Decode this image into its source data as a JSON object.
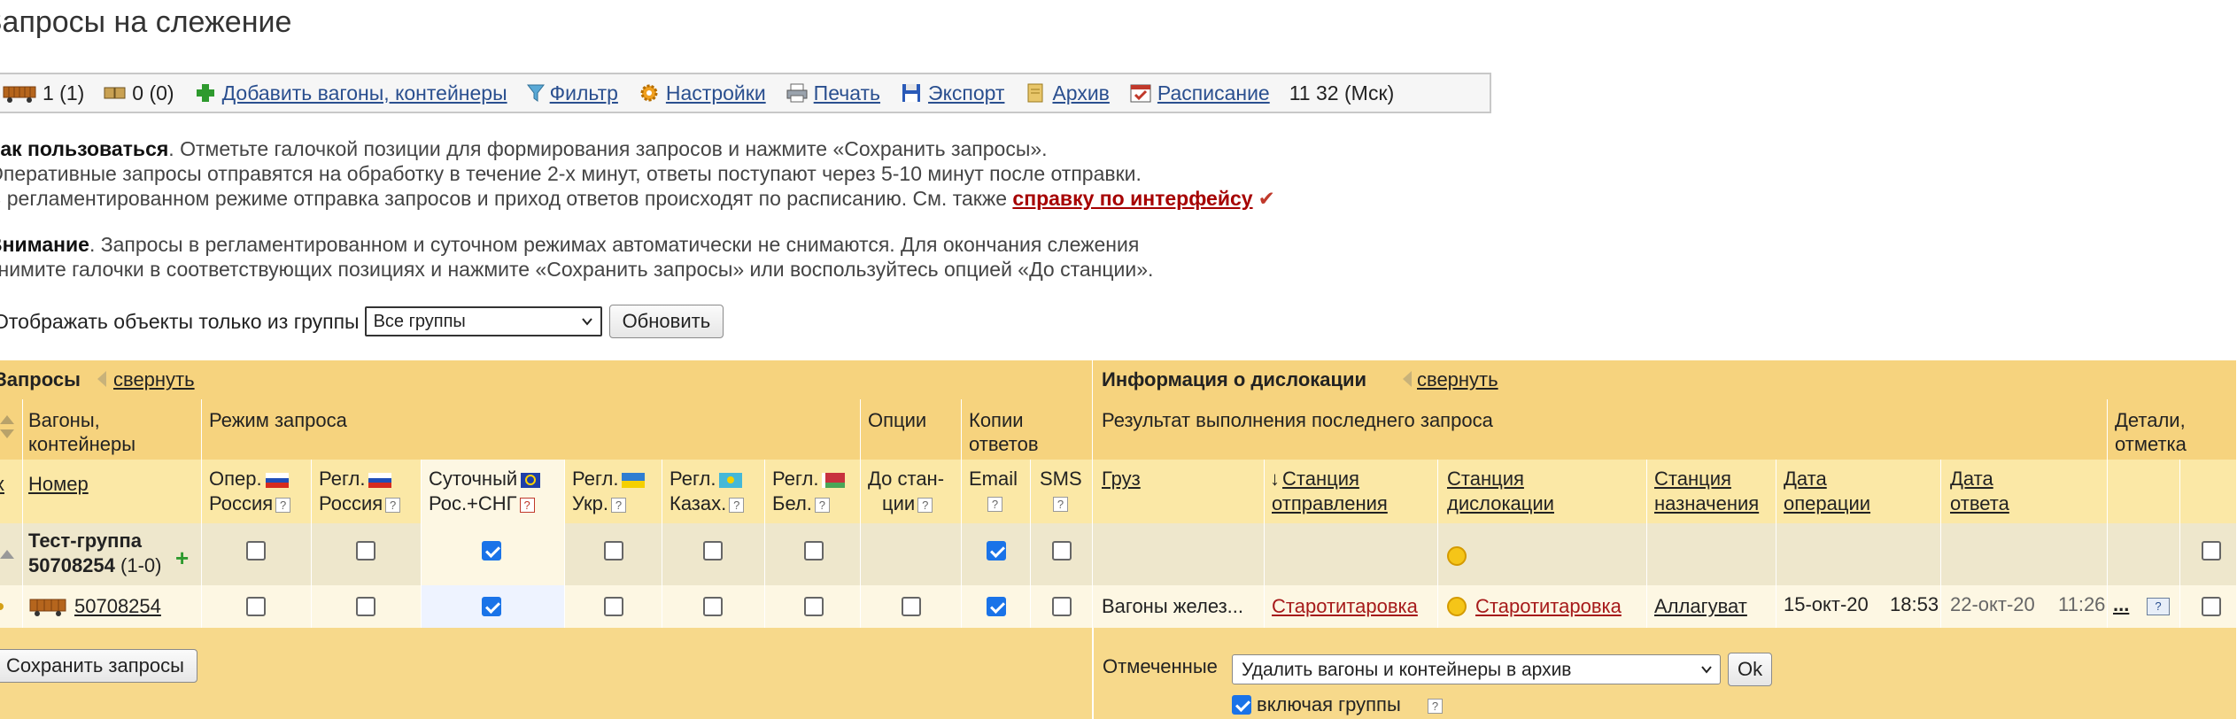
{
  "page": {
    "title": "Запросы на слежение"
  },
  "toolbar": {
    "wagons_count": "1 (1)",
    "containers_count": "0 (0)",
    "add": "Добавить вагоны, контейнеры",
    "filter": "Фильтр",
    "settings": "Настройки",
    "print": "Печать",
    "export": "Экспорт",
    "archive": "Архив",
    "schedule": "Расписание",
    "time": "11 32 (Мск)"
  },
  "help": {
    "how_bold": "Как пользоваться",
    "how_text": ". Отметьте галочкой позиции для формирования запросов и нажмите «Сохранить запросы».",
    "line2": "Оперативные запросы отправятся на обработку в течение 2-х минут, ответы поступают через 5-10 минут после отправки.",
    "line3": "В регламентированном режиме отправка запросов и приход ответов происходят по расписанию. См. также ",
    "link": "справку по интерфейсу",
    "attention_bold": "Внимание",
    "attention_text": ". Запросы в регламентированном и суточном режимах автоматически не снимаются. Для окончания слежения",
    "attention_line2": "снимите галочки в соответствующих позициях и нажмите «Сохранить запросы» или воспользуйтесь опцией «До станции»."
  },
  "filter": {
    "label": "Отображать объекты только из группы",
    "selected": "Все группы",
    "refresh": "Обновить"
  },
  "table": {
    "requests_title": "Запросы",
    "collapse": "свернуть",
    "dislocation_title": "Информация о дислокации",
    "col_wagons": "Вагоны, контейнеры",
    "col_mode": "Режим запроса",
    "col_options": "Опции",
    "col_copies": "Копии ответов",
    "col_result": "Результат выполнения последнего запроса",
    "col_details": "Детали, отметка",
    "col_number": "Номер",
    "modes": [
      {
        "line1": "Опер.",
        "line2": "Россия"
      },
      {
        "line1": "Регл.",
        "line2": "Россия"
      },
      {
        "line1": "Суточный",
        "line2": "Рос.+СНГ"
      },
      {
        "line1": "Регл.",
        "line2": "Укр."
      },
      {
        "line1": "Регл.",
        "line2": "Казах."
      },
      {
        "line1": "Регл.",
        "line2": "Бел."
      }
    ],
    "to_station": {
      "line1": "До стан-",
      "line2": "ции"
    },
    "email": "Email",
    "sms": "SMS",
    "result_cols": {
      "cargo": "Груз",
      "dep_station_1": "Станция",
      "dep_station_2": "отправления",
      "disl_station_1": "Станция",
      "disl_station_2": "дислокации",
      "dest_station_1": "Станция",
      "dest_station_2": "назначения",
      "op_date_1": "Дата",
      "op_date_2": "операции",
      "ans_date_1": "Дата",
      "ans_date_2": "ответа"
    },
    "group_row": {
      "name": "Тест-группа",
      "number": "50708254",
      "count": "(1-0)",
      "checks": [
        false,
        false,
        true,
        false,
        false,
        false,
        true,
        false
      ]
    },
    "data_row": {
      "number": "50708254",
      "checks": [
        false,
        false,
        true,
        false,
        false,
        false,
        false,
        true,
        false
      ],
      "cargo": "Вагоны желез...",
      "dep_station": "Старотитаровка",
      "disl_station": "Старотитаровка",
      "dest_station": "Аллагуват",
      "op_date": "15-окт-20",
      "op_time": "18:53",
      "ans_date": "22-окт-20",
      "ans_time": "11:26",
      "more": "..."
    },
    "save": "Сохранить запросы",
    "marked_label": "Отмеченные",
    "marked_action": "Удалить вагоны и контейнеры в архив",
    "ok": "Ok",
    "include_groups": "включая группы"
  },
  "colors": {
    "header_dark": "#f6d37e",
    "header_light": "#fbe8a6",
    "link": "#2a4f8f",
    "help_link": "#a60000"
  }
}
